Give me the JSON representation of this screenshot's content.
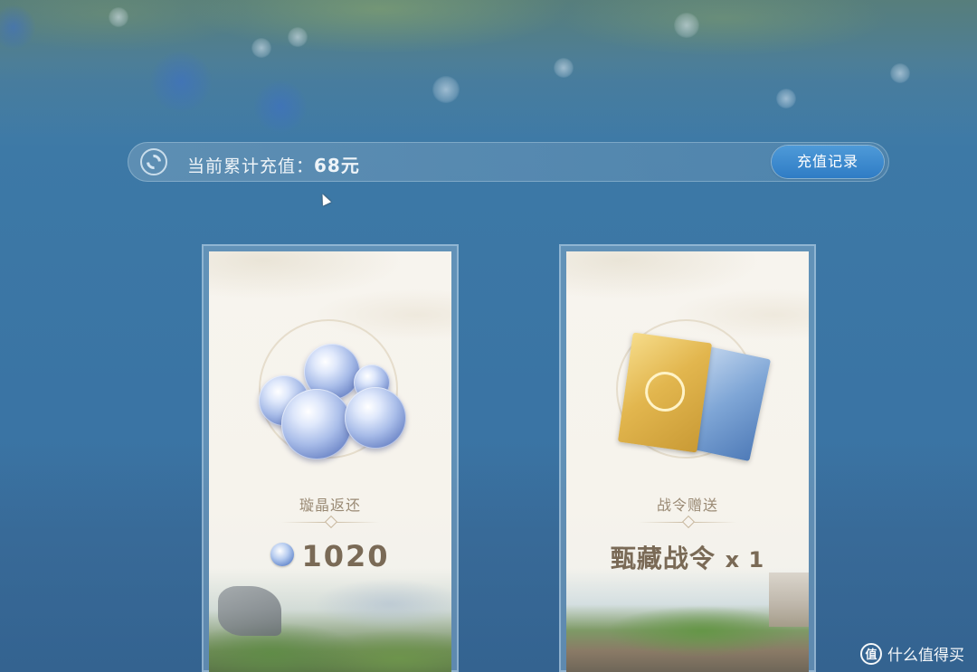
{
  "top_bar": {
    "label": "当前累计充值：",
    "amount": "68元",
    "record_button": "充值记录"
  },
  "cards": [
    {
      "title": "璇晶返还",
      "value": "1020"
    },
    {
      "title": "战令赠送",
      "value": "甄藏战令",
      "multiplier": "x 1"
    }
  ],
  "watermark": {
    "icon_text": "值",
    "text": "什么值得买"
  },
  "colors": {
    "record_button": "#2f7cc5",
    "card_text": "#7a6a56",
    "background": "#3a74a4"
  }
}
